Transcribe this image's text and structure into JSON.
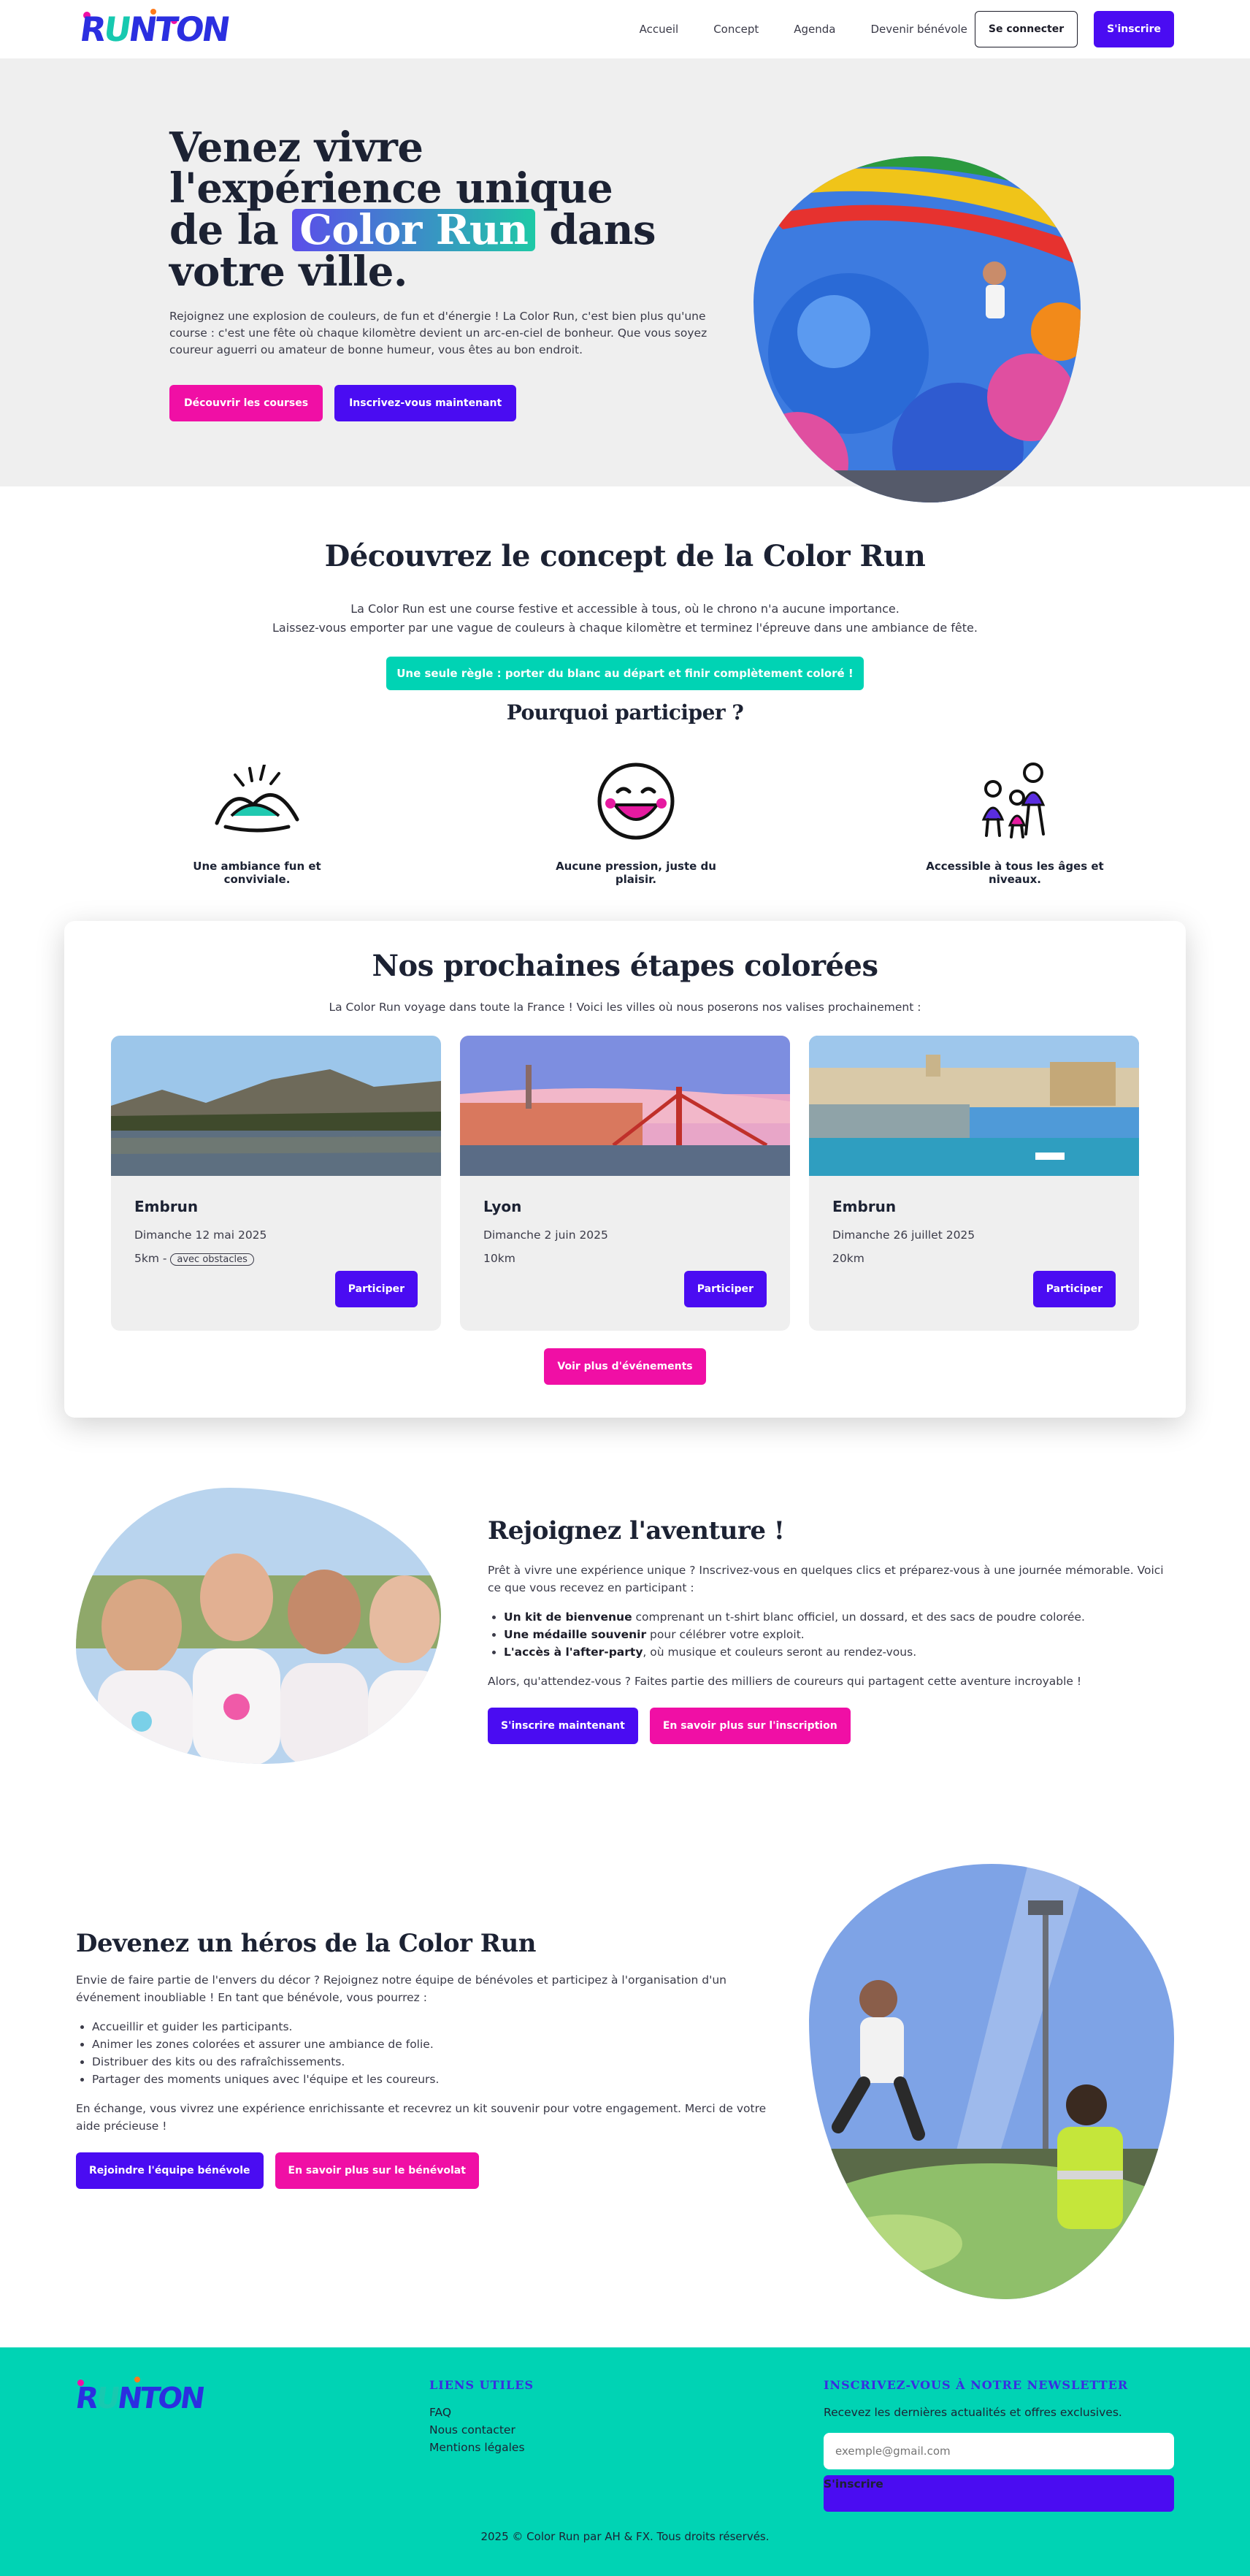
{
  "brand": {
    "logo_text": "RUNTON",
    "accent_violet": "#4a0cf2",
    "accent_pink": "#f00fa5",
    "accent_teal": "#00d3b4"
  },
  "nav": {
    "links": [
      "Accueil",
      "Concept",
      "Agenda",
      "Devenir bénévole"
    ],
    "login": "Se connecter",
    "signup": "S'inscrire"
  },
  "hero": {
    "title_line1": "Venez vivre",
    "title_line2": "l'expérience unique",
    "title_pre": "de la",
    "title_highlight": "Color Run",
    "title_post": "dans",
    "title_line4": "votre ville.",
    "text": "Rejoignez une explosion de couleurs, de fun et d'énergie ! La Color Run, c'est bien plus qu'une course : c'est une fête où chaque kilomètre devient un arc-en-ciel de bonheur. Que vous soyez coureur aguerri ou amateur de bonne humeur, vous êtes au bon endroit.",
    "btn_discover": "Découvrir les courses",
    "btn_signup": "Inscrivez-vous maintenant"
  },
  "concept": {
    "title": "Découvrez le concept de la Color Run",
    "lead_1": "La Color Run est une course festive et accessible à tous, où le chrono n'a aucune importance.",
    "lead_2": "Laissez-vous emporter par une vague de couleurs à chaque kilomètre et terminez l'épreuve dans une ambiance de fête.",
    "rule": "Une seule règle : porter du blanc au départ et finir complètement coloré !",
    "why_title": "Pourquoi participer ?",
    "features": [
      {
        "icon": "party-hat-icon",
        "label": "Une ambiance fun et conviviale."
      },
      {
        "icon": "smiley-face-icon",
        "label": "Aucune pression, juste du plaisir."
      },
      {
        "icon": "family-icon",
        "label": "Accessible à tous les âges et niveaux."
      }
    ]
  },
  "events": {
    "title": "Nos prochaines étapes colorées",
    "subtitle": "La Color Run voyage dans toute la France ! Voici les villes où nous poserons nos valises prochainement :",
    "cards": [
      {
        "city": "Embrun",
        "date": "Dimanche 12 mai 2025",
        "distance": "5km",
        "separator": " - ",
        "tag": "avec obstacles",
        "button": "Participer"
      },
      {
        "city": "Lyon",
        "date": "Dimanche 2 juin 2025",
        "distance": "10km",
        "separator": "",
        "tag": "",
        "button": "Participer"
      },
      {
        "city": "Embrun",
        "date": "Dimanche 26 juillet 2025",
        "distance": "20km",
        "separator": "",
        "tag": "",
        "button": "Participer"
      }
    ],
    "more": "Voir plus d'événements"
  },
  "join": {
    "title": "Rejoignez l'aventure !",
    "intro": "Prêt à vivre une expérience unique ? Inscrivez-vous en quelques clics et préparez-vous à une journée mémorable. Voici ce que vous recevez en participant :",
    "items": [
      {
        "bold": "Un kit de bienvenue",
        "rest": " comprenant un t-shirt blanc officiel, un dossard, et des sacs de poudre colorée."
      },
      {
        "bold": "Une médaille souvenir",
        "rest": " pour célébrer votre exploit."
      },
      {
        "bold": "L'accès à l'after-party",
        "rest": ", où musique et couleurs seront au rendez-vous."
      }
    ],
    "outro": "Alors, qu'attendez-vous ? Faites partie des milliers de coureurs qui partagent cette aventure incroyable !",
    "btn_signup": "S'inscrire maintenant",
    "btn_more": "En savoir plus sur l'inscription"
  },
  "volunteer": {
    "title": "Devenez un héros de la Color Run",
    "intro": "Envie de faire partie de l'envers du décor ? Rejoignez notre équipe de bénévoles et participez à l'organisation d'un événement inoubliable ! En tant que bénévole, vous pourrez :",
    "items": [
      "Accueillir et guider les participants.",
      "Animer les zones colorées et assurer une ambiance de folie.",
      "Distribuer des kits ou des rafraîchissements.",
      "Partager des moments uniques avec l'équipe et les coureurs."
    ],
    "outro": "En échange, vous vivrez une expérience enrichissante et recevrez un kit souvenir pour votre engagement. Merci de votre aide précieuse !",
    "btn_join": "Rejoindre l'équipe bénévole",
    "btn_more": "En savoir plus sur le bénévolat"
  },
  "footer": {
    "links_title": "LIENS UTILES",
    "links": [
      "FAQ",
      "Nous contacter",
      "Mentions légales"
    ],
    "newsletter_title": "INSCRIVEZ-VOUS À NOTRE NEWSLETTER",
    "newsletter_text": "Recevez les dernières actualités et offres exclusives.",
    "email_placeholder": "exemple@gmail.com",
    "newsletter_btn": "S'inscrire",
    "copyright": "2025 © Color Run par AH & FX. Tous droits réservés."
  }
}
